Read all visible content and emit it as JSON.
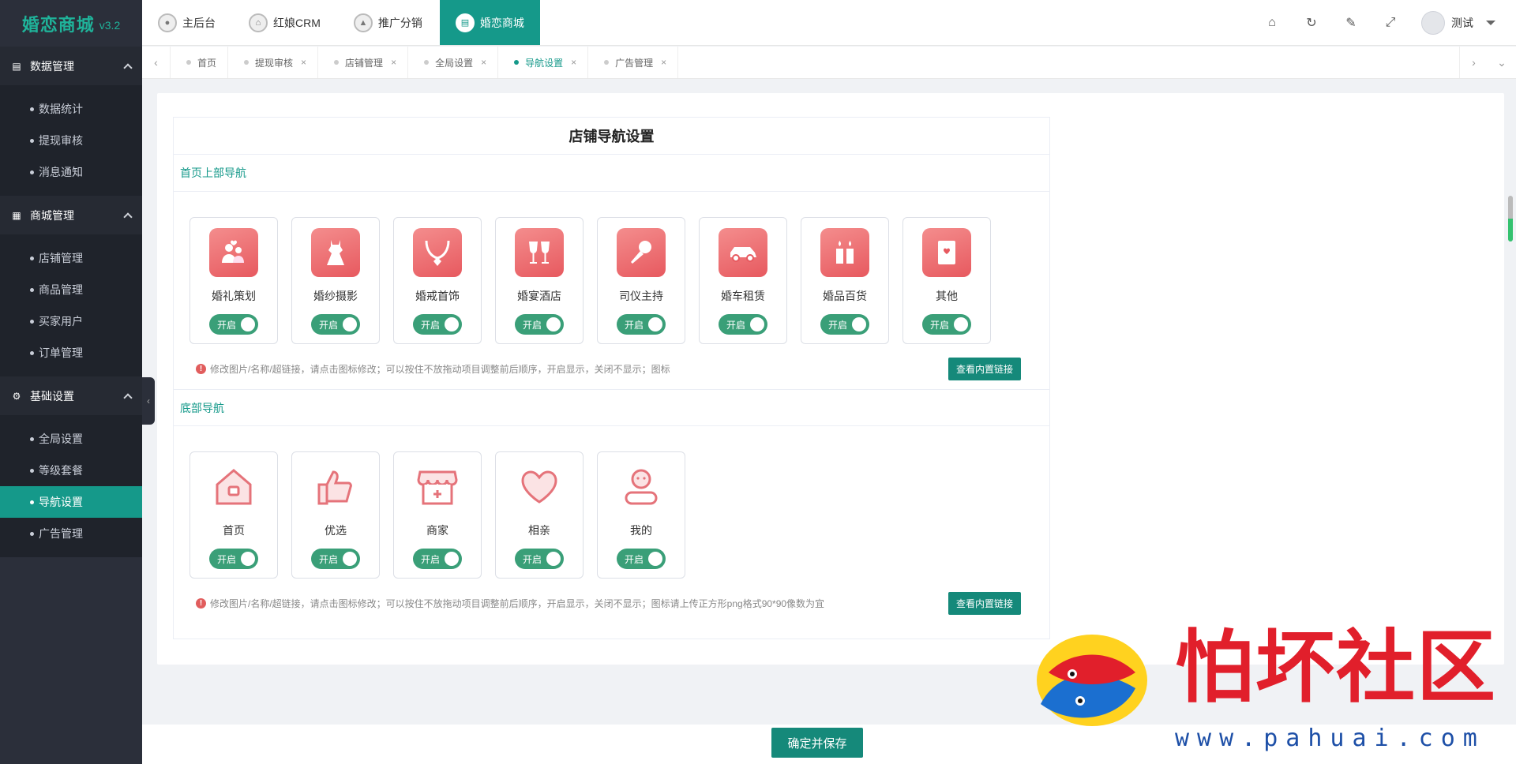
{
  "app": {
    "name": "婚恋商城",
    "version": "v3.2"
  },
  "sidebar": {
    "groups": [
      {
        "title": "数据管理",
        "items": [
          "数据统计",
          "提现审核",
          "消息通知"
        ]
      },
      {
        "title": "商城管理",
        "items": [
          "店铺管理",
          "商品管理",
          "买家用户",
          "订单管理"
        ]
      },
      {
        "title": "基础设置",
        "items": [
          "全局设置",
          "等级套餐",
          "导航设置",
          "广告管理"
        ]
      }
    ],
    "active_item": "导航设置"
  },
  "topbar": {
    "tabs": [
      "主后台",
      "红娘CRM",
      "推广分销",
      "婚恋商城"
    ],
    "active_tab": "婚恋商城",
    "user_name": "测试"
  },
  "page_tabs": {
    "tabs": [
      "首页",
      "提现审核",
      "店铺管理",
      "全局设置",
      "导航设置",
      "广告管理"
    ],
    "active": "导航设置"
  },
  "panel": {
    "title": "店铺导航设置",
    "top_section": {
      "heading": "首页上部导航",
      "items": [
        {
          "label": "婚礼策划",
          "icon": "couple-icon",
          "toggle": "开启"
        },
        {
          "label": "婚纱摄影",
          "icon": "wedding-dress-icon",
          "toggle": "开启"
        },
        {
          "label": "婚戒首饰",
          "icon": "necklace-icon",
          "toggle": "开启"
        },
        {
          "label": "婚宴酒店",
          "icon": "wine-glasses-icon",
          "toggle": "开启"
        },
        {
          "label": "司仪主持",
          "icon": "microphone-icon",
          "toggle": "开启"
        },
        {
          "label": "婚车租赁",
          "icon": "car-icon",
          "toggle": "开启"
        },
        {
          "label": "婚品百货",
          "icon": "candles-icon",
          "toggle": "开启"
        },
        {
          "label": "其他",
          "icon": "book-icon",
          "toggle": "开启"
        }
      ],
      "hint": "修改图片/名称/超链接，请点击图标修改；可以按住不放拖动项目调整前后顺序，开启显示，关闭不显示；图标",
      "link_button": "查看内置链接"
    },
    "bottom_section": {
      "heading": "底部导航",
      "items": [
        {
          "label": "首页",
          "icon": "home-icon",
          "toggle": "开启"
        },
        {
          "label": "优选",
          "icon": "thumbs-up-icon",
          "toggle": "开启"
        },
        {
          "label": "商家",
          "icon": "shop-icon",
          "toggle": "开启"
        },
        {
          "label": "相亲",
          "icon": "heart-icon",
          "toggle": "开启"
        },
        {
          "label": "我的",
          "icon": "user-icon",
          "toggle": "开启"
        }
      ],
      "hint": "修改图片/名称/超链接，请点击图标修改；可以按住不放拖动项目调整前后顺序，开启显示，关闭不显示；图标请上传正方形png格式90*90像数为宜",
      "link_button": "查看内置链接"
    }
  },
  "footer": {
    "save_label": "确定并保存"
  },
  "watermark": {
    "text": "怕坏社区",
    "url": "www.pahuai.com"
  },
  "colors": {
    "accent": "#15998a",
    "icon_gradient": "#e7595f",
    "toggle_on": "#3a9f78",
    "sidebar_bg": "#2b2f3a"
  }
}
